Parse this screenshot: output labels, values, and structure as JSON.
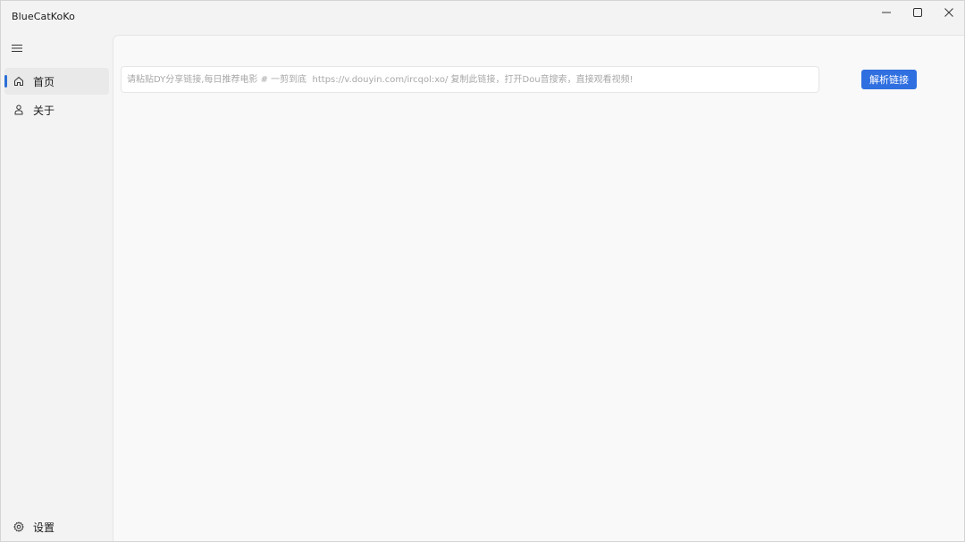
{
  "window": {
    "title": "BlueCatKoKo"
  },
  "sidebar": {
    "items": [
      {
        "label": "首页",
        "icon": "home-icon",
        "active": true
      },
      {
        "label": "关于",
        "icon": "about-icon",
        "active": false
      }
    ],
    "footer": {
      "label": "设置",
      "icon": "gear-icon"
    }
  },
  "main": {
    "url_input": {
      "value": "",
      "placeholder": "请粘贴DY分享链接,每日推荐电影 # 一剪到底  https://v.douyin.com/ircqol:xo/ 复制此链接，打开Dou音搜索，直接观看视频!"
    },
    "parse_button_label": "解析链接"
  },
  "colors": {
    "accent": "#2f6fe0",
    "indicator": "#2b6fd6",
    "sidebar_bg": "#f3f3f3",
    "content_bg": "#f9f9f9"
  }
}
